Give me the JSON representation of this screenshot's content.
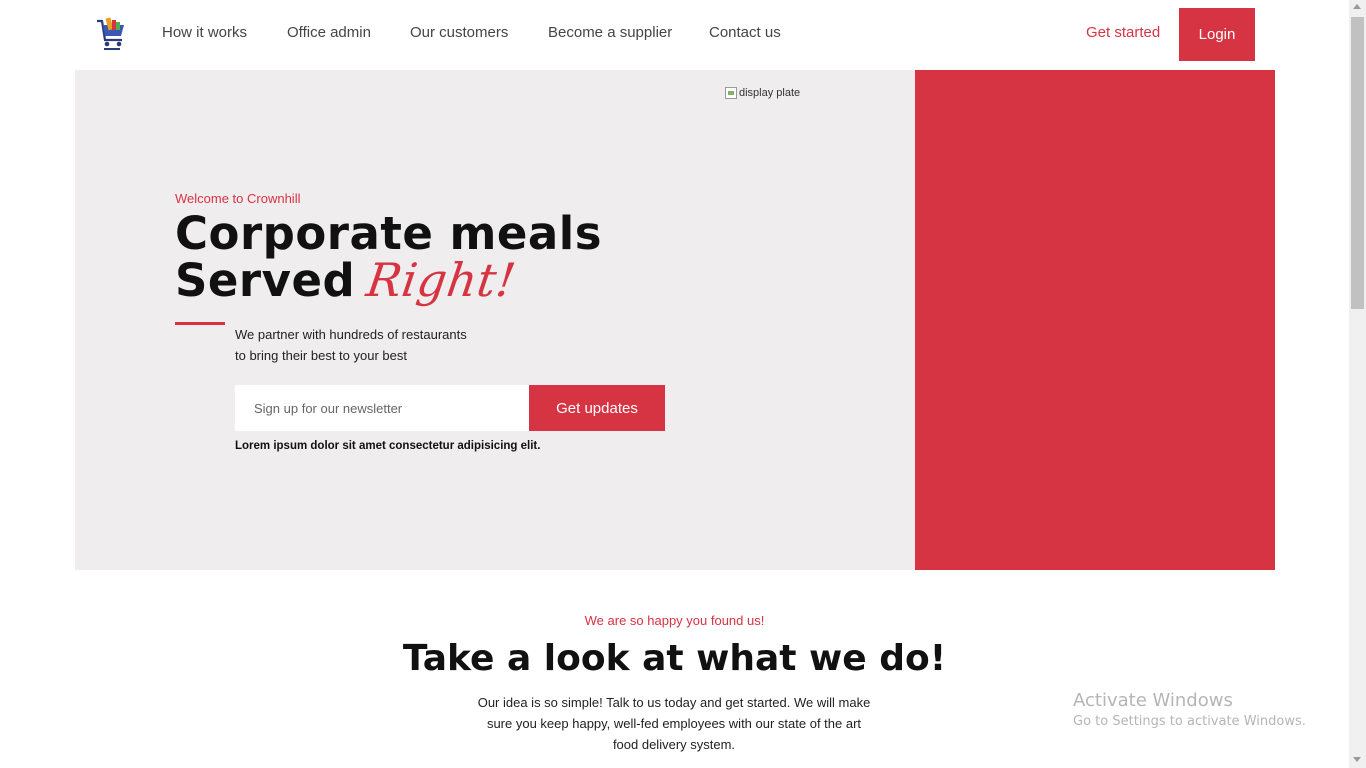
{
  "nav": {
    "logo_icon": "shopping-cart-logo-icon",
    "links": [
      "How it works",
      "Office admin",
      "Our customers",
      "Become a supplier",
      "Contact us"
    ],
    "get_started": "Get started",
    "login": "Login"
  },
  "hero": {
    "image_alt": "display plate",
    "welcome": "Welcome to Crownhill",
    "headline_line1": "Corporate meals",
    "headline_line2": "Served",
    "headline_script": "Right!",
    "subtext_line1": "We partner with hundreds of restaurants",
    "subtext_line2": "to bring their best to your best",
    "newsletter_placeholder": "Sign up for our newsletter",
    "newsletter_button": "Get updates",
    "lorem": "Lorem ipsum dolor sit amet consectetur adipisicing elit."
  },
  "section": {
    "eyebrow": "We are so happy you found us!",
    "title": "Take a look at what we do!",
    "description": "Our idea is so simple! Talk to us today and get started. We will make sure you keep happy, well-fed employees with our state of the art food delivery system."
  },
  "watermark": {
    "title": "Activate Windows",
    "subtitle": "Go to Settings to activate Windows."
  },
  "colors": {
    "accent": "#d63343",
    "hero_bg": "#efedee",
    "text": "#111111"
  }
}
